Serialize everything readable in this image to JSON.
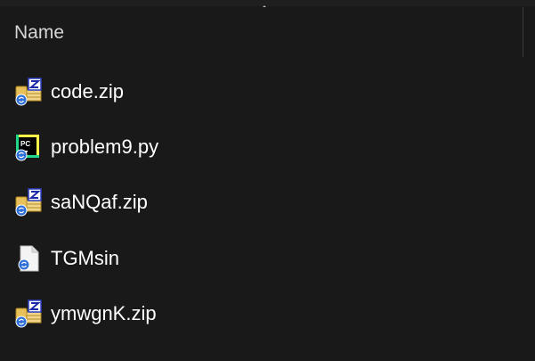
{
  "header": {
    "name_label": "Name"
  },
  "files": [
    {
      "name": "code.zip",
      "icon": "zip-archive-icon"
    },
    {
      "name": "problem9.py",
      "icon": "pycharm-file-icon"
    },
    {
      "name": "saNQaf.zip",
      "icon": "zip-archive-icon"
    },
    {
      "name": "TGMsin",
      "icon": "generic-file-icon"
    },
    {
      "name": "ymwgnK.zip",
      "icon": "zip-archive-icon"
    }
  ],
  "colors": {
    "background": "#191919",
    "text": "#ffffff",
    "header_text": "#d6d6d6",
    "sync_badge": "#2f6fd8"
  }
}
